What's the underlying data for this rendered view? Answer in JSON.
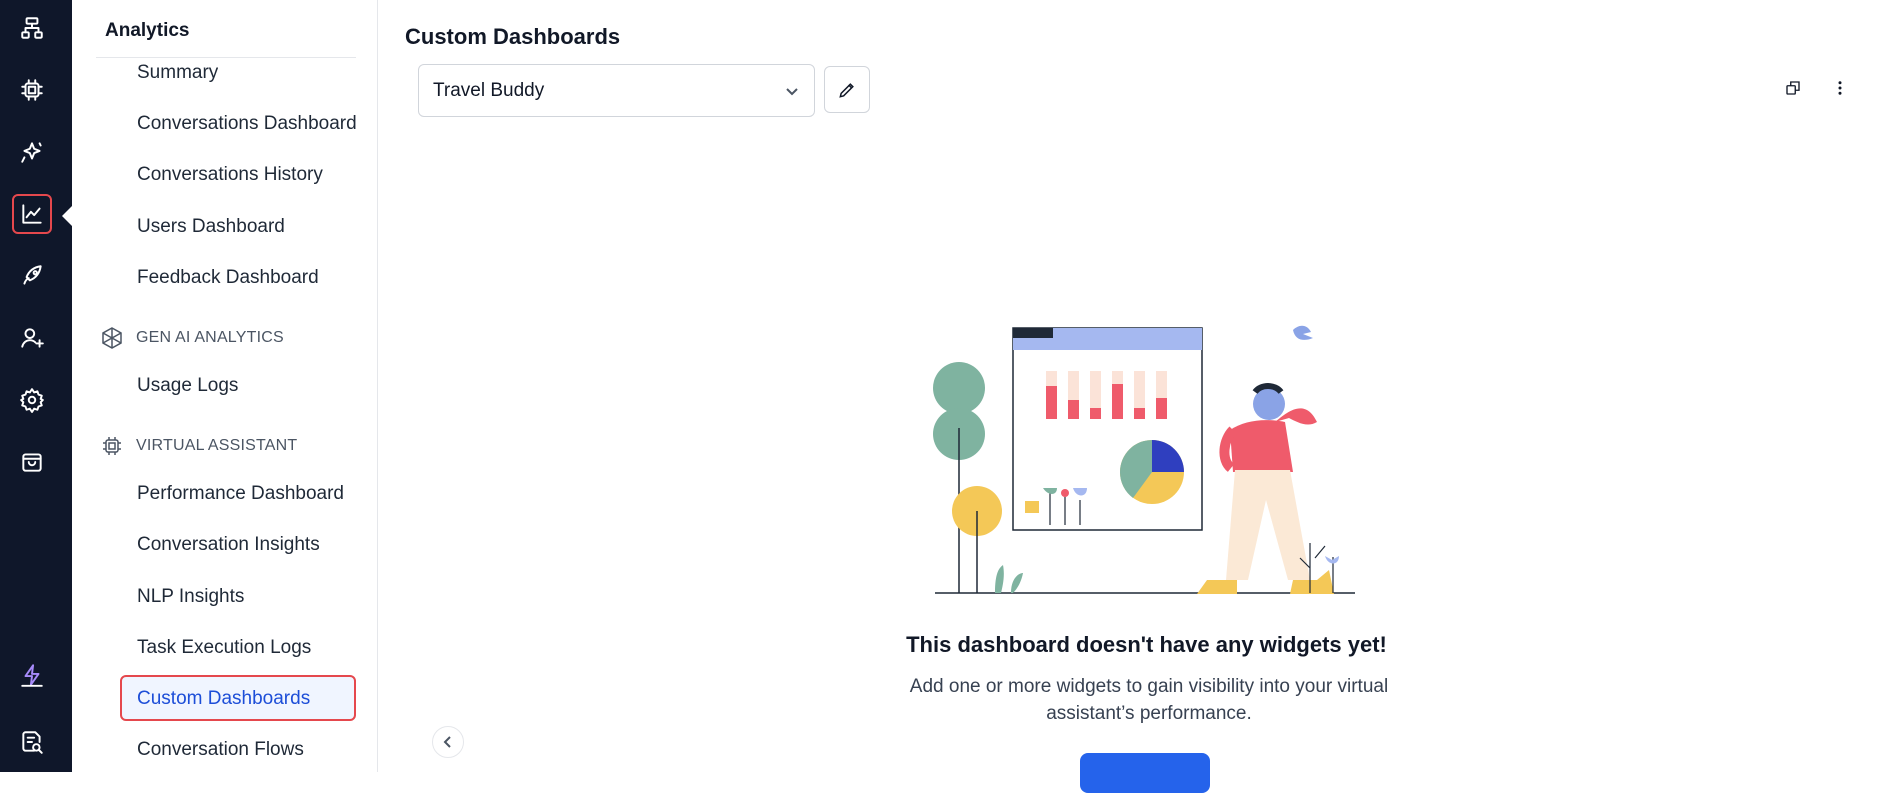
{
  "rail": {
    "icons": [
      {
        "name": "flow-icon"
      },
      {
        "name": "chip-icon"
      },
      {
        "name": "sparkles-icon"
      },
      {
        "name": "analytics-chart-icon",
        "active": true
      },
      {
        "name": "rocket-icon"
      },
      {
        "name": "add-user-icon"
      },
      {
        "name": "gear-icon"
      },
      {
        "name": "shopping-bag-icon"
      },
      {
        "name": "lightning-icon"
      },
      {
        "name": "search-doc-icon"
      }
    ]
  },
  "subnav": {
    "title": "Analytics",
    "items_top": [
      "Summary",
      "Conversations Dashboard",
      "Conversations History",
      "Users Dashboard",
      "Feedback Dashboard"
    ],
    "section_genai": "GEN AI ANALYTICS",
    "items_genai": [
      "Usage Logs"
    ],
    "section_va": "VIRTUAL ASSISTANT",
    "items_va": [
      "Performance Dashboard",
      "Conversation Insights",
      "NLP Insights",
      "Task Execution Logs",
      "Custom Dashboards",
      "Conversation Flows"
    ],
    "active_item": "Custom Dashboards"
  },
  "main": {
    "title": "Custom Dashboards",
    "dashboard_select": "Travel Buddy",
    "empty_title": "This dashboard doesn't have any widgets yet!",
    "empty_desc": "Add one or more widgets to gain visibility into your virtual assistant’s performance."
  },
  "colors": {
    "rail_bg": "#0f172a",
    "active_border": "#e5484d",
    "active_text": "#1d4ed8",
    "primary": "#2563eb"
  }
}
